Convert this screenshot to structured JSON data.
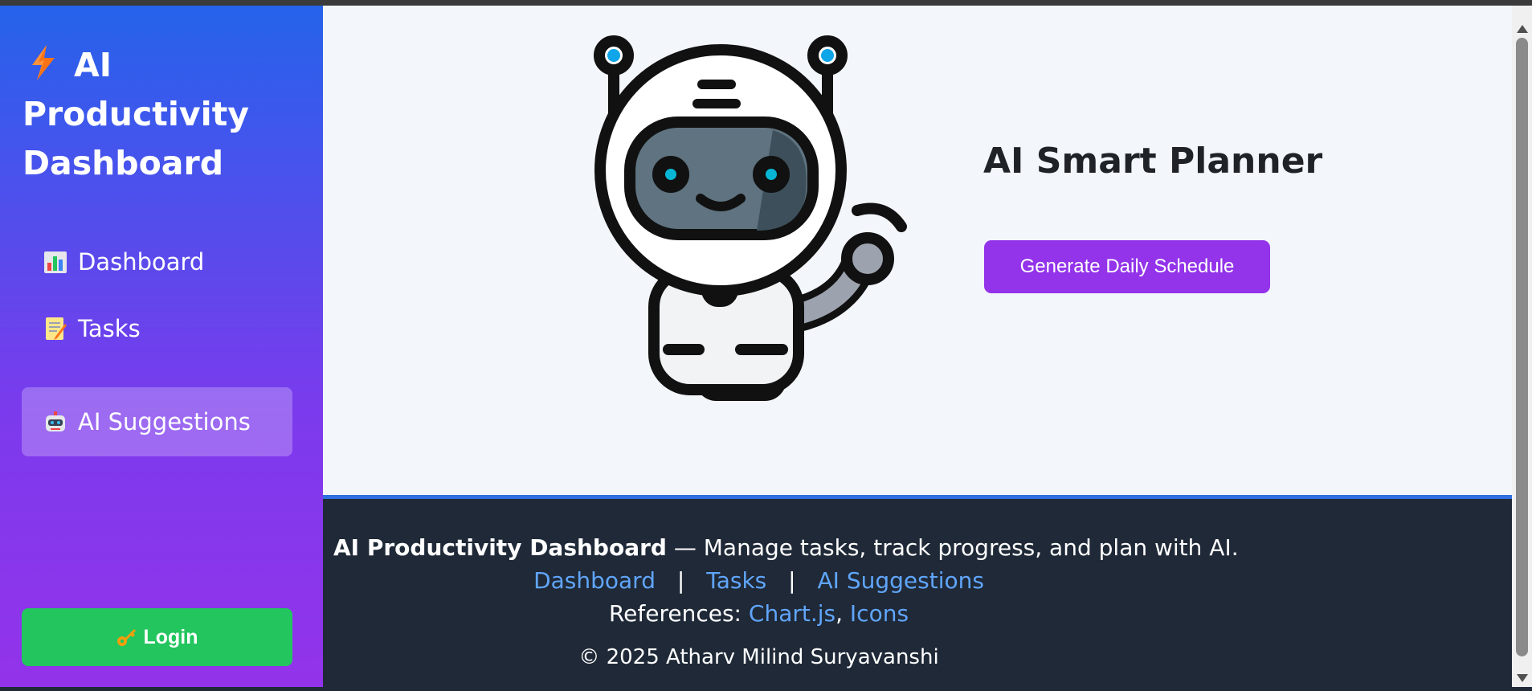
{
  "sidebar": {
    "brand": {
      "icon": "lightning-bolt-icon",
      "line1": "AI",
      "line2": "Productivity",
      "line3": "Dashboard"
    },
    "items": [
      {
        "label": "Dashboard",
        "icon": "bar-chart-icon"
      },
      {
        "label": "Tasks",
        "icon": "memo-icon"
      },
      {
        "label": "AI Suggestions",
        "icon": "robot-icon",
        "active": true
      }
    ],
    "login": {
      "label": "Login",
      "icon": "key-icon"
    }
  },
  "main": {
    "title": "AI Smart Planner",
    "button_label": "Generate Daily Schedule",
    "illustration": "robot-waving-icon"
  },
  "footer": {
    "brand": "AI Productivity Dashboard",
    "tagline": "— Manage tasks, track progress, and plan with AI.",
    "links": [
      "Dashboard",
      "Tasks",
      "AI Suggestions"
    ],
    "separator": "|",
    "references_label": "References:",
    "references": [
      "Chart.js",
      "Icons"
    ],
    "copyright": "© 2025 Atharv Milind Suryavanshi"
  },
  "colors": {
    "sidebar_top": "#2563eb",
    "sidebar_bottom": "#9333ea",
    "primary_button": "#9333ea",
    "login_button": "#22c55e",
    "footer_bg": "#1f2937",
    "link": "#60a5fa"
  }
}
